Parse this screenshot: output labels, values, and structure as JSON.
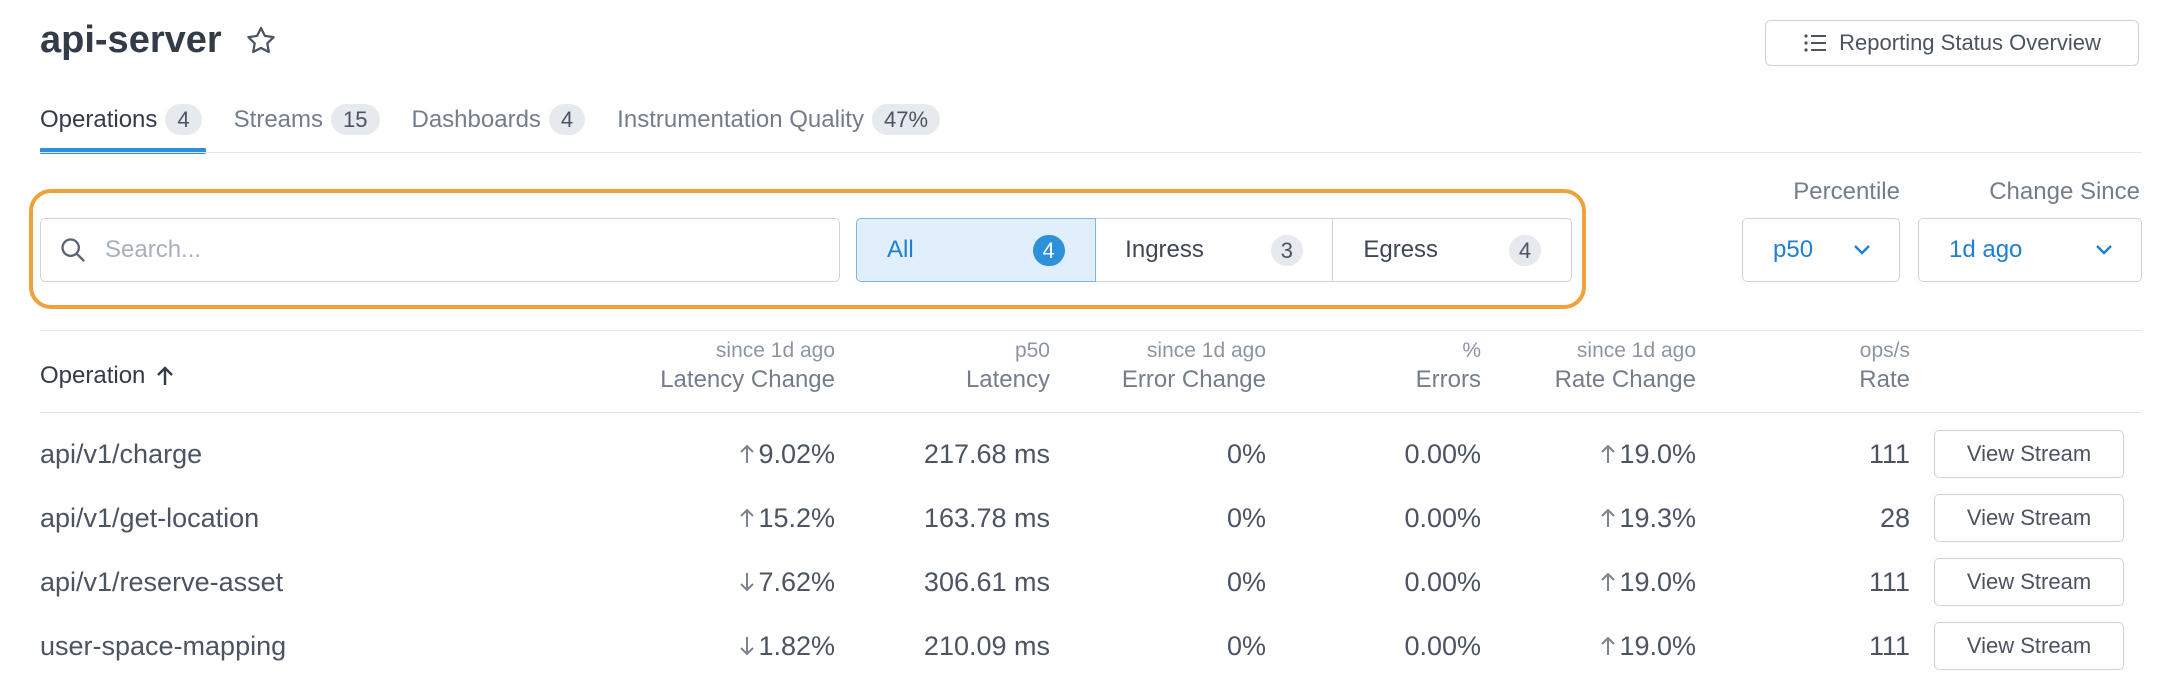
{
  "header": {
    "title": "api-server",
    "report_button": "Reporting Status Overview"
  },
  "tabs": [
    {
      "label": "Operations",
      "count": "4",
      "active": true
    },
    {
      "label": "Streams",
      "count": "15"
    },
    {
      "label": "Dashboards",
      "count": "4"
    },
    {
      "label": "Instrumentation Quality",
      "count": "47%"
    }
  ],
  "filters": {
    "search_placeholder": "Search...",
    "segments": [
      {
        "label": "All",
        "count": "4",
        "active": true
      },
      {
        "label": "Ingress",
        "count": "3"
      },
      {
        "label": "Egress",
        "count": "4"
      }
    ],
    "percentile": {
      "label": "Percentile",
      "value": "p50"
    },
    "change_since": {
      "label": "Change Since",
      "value": "1d ago"
    }
  },
  "table": {
    "op_header": "Operation",
    "columns": [
      {
        "sub": "since 1d ago",
        "main": "Latency Change"
      },
      {
        "sub": "p50",
        "main": "Latency"
      },
      {
        "sub": "since 1d ago",
        "main": "Error Change"
      },
      {
        "sub": "%",
        "main": "Errors"
      },
      {
        "sub": "since 1d ago",
        "main": "Rate Change"
      },
      {
        "sub": "ops/s",
        "main": "Rate"
      }
    ],
    "view_label": "View Stream",
    "rows": [
      {
        "op": "api/v1/charge",
        "lat_dir": "up",
        "lat_chg": "9.02%",
        "latency": "217.68 ms",
        "err_chg": "0%",
        "errors": "0.00%",
        "rate_dir": "up",
        "rate_chg": "19.0%",
        "rate": "111"
      },
      {
        "op": "api/v1/get-location",
        "lat_dir": "up",
        "lat_chg": "15.2%",
        "latency": "163.78 ms",
        "err_chg": "0%",
        "errors": "0.00%",
        "rate_dir": "up",
        "rate_chg": "19.3%",
        "rate": "28"
      },
      {
        "op": "api/v1/reserve-asset",
        "lat_dir": "down",
        "lat_chg": "7.62%",
        "latency": "306.61 ms",
        "err_chg": "0%",
        "errors": "0.00%",
        "rate_dir": "up",
        "rate_chg": "19.0%",
        "rate": "111"
      },
      {
        "op": "user-space-mapping",
        "lat_dir": "down",
        "lat_chg": "1.82%",
        "latency": "210.09 ms",
        "err_chg": "0%",
        "errors": "0.00%",
        "rate_dir": "up",
        "rate_chg": "19.0%",
        "rate": "111"
      }
    ]
  },
  "colors": {
    "accent": "#2e8fdb",
    "highlight": "#f0a23a",
    "text": "#3d4856"
  }
}
